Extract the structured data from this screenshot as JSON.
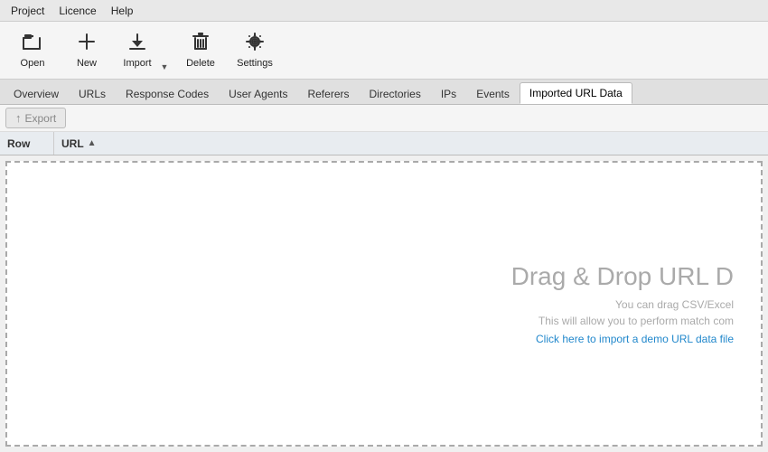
{
  "menu": {
    "items": [
      {
        "id": "project",
        "label": "Project"
      },
      {
        "id": "licence",
        "label": "Licence"
      },
      {
        "id": "help",
        "label": "Help"
      }
    ]
  },
  "toolbar": {
    "buttons": [
      {
        "id": "open",
        "label": "Open",
        "icon": "📂"
      },
      {
        "id": "new",
        "label": "New",
        "icon": "✚"
      },
      {
        "id": "delete",
        "label": "Delete",
        "icon": "🗑"
      },
      {
        "id": "settings",
        "label": "Settings",
        "icon": "⚙"
      }
    ],
    "import": {
      "label": "Import",
      "icon": "⬇"
    }
  },
  "tabs": [
    {
      "id": "overview",
      "label": "Overview",
      "active": false
    },
    {
      "id": "urls",
      "label": "URLs",
      "active": false
    },
    {
      "id": "response-codes",
      "label": "Response Codes",
      "active": false
    },
    {
      "id": "user-agents",
      "label": "User Agents",
      "active": false
    },
    {
      "id": "referers",
      "label": "Referers",
      "active": false
    },
    {
      "id": "directories",
      "label": "Directories",
      "active": false
    },
    {
      "id": "ips",
      "label": "IPs",
      "active": false
    },
    {
      "id": "events",
      "label": "Events",
      "active": false
    },
    {
      "id": "imported-url-data",
      "label": "Imported URL Data",
      "active": true
    }
  ],
  "action_bar": {
    "export_label": "Export",
    "export_icon": "↑"
  },
  "table": {
    "col_row": "Row",
    "col_url": "URL",
    "sort_icon": "▲"
  },
  "drop_zone": {
    "title": "Drag & Drop URL D",
    "sub1": "You can drag CSV/Excel",
    "sub2": "This will allow you to perform match com",
    "link_text": "Click here to import a demo URL data file"
  }
}
